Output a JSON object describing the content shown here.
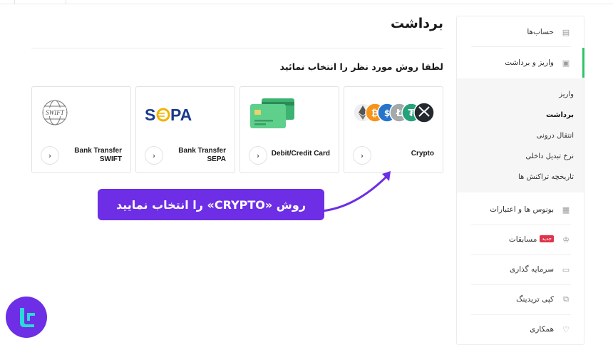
{
  "page": {
    "title": "برداشت",
    "subtitle": "لطفا روش مورد نظر را انتخاب نمائید"
  },
  "methods": [
    {
      "label": "Crypto",
      "logo": "crypto-coins-icon"
    },
    {
      "label": "Debit/Credit Card",
      "logo": "credit-card-icon"
    },
    {
      "label_line1": "Bank Transfer",
      "label_line2": "SEPA",
      "logo_text": "SEPA",
      "logo": "sepa-logo"
    },
    {
      "label_line1": "Bank Transfer",
      "label_line2": "SWIFT",
      "logo_text": "SWIFT",
      "logo": "swift-logo"
    }
  ],
  "callout": {
    "text": "روش «CRYPTO» را انتخاب نمایید",
    "color": "#6d2ee6"
  },
  "sidebar": {
    "items": [
      {
        "label": "حساب‌ها",
        "icon": "accounts-icon"
      },
      {
        "label": "واریز و برداشت",
        "icon": "wallet-icon"
      },
      {
        "label": "بونوس ها و اعتبارات",
        "icon": "bonus-icon"
      },
      {
        "label": "مسابقات",
        "icon": "trophy-icon",
        "badge": "جدید"
      },
      {
        "label": "سرمایه گذاری",
        "icon": "briefcase-icon"
      },
      {
        "label": "کپی تریدینگ",
        "icon": "copy-trading-icon"
      },
      {
        "label": "همکاری",
        "icon": "handshake-icon"
      }
    ],
    "sub_items": [
      {
        "label": "واریز"
      },
      {
        "label": "برداشت"
      },
      {
        "label": "انتقال درونی"
      },
      {
        "label": "نرخ تبدیل داخلی"
      },
      {
        "label": "تاریخچه تراکنش ها"
      }
    ],
    "active_color": "#2ec46a"
  },
  "brand": {
    "icon": "brand-logo-icon",
    "color": "#6d2ee6"
  }
}
